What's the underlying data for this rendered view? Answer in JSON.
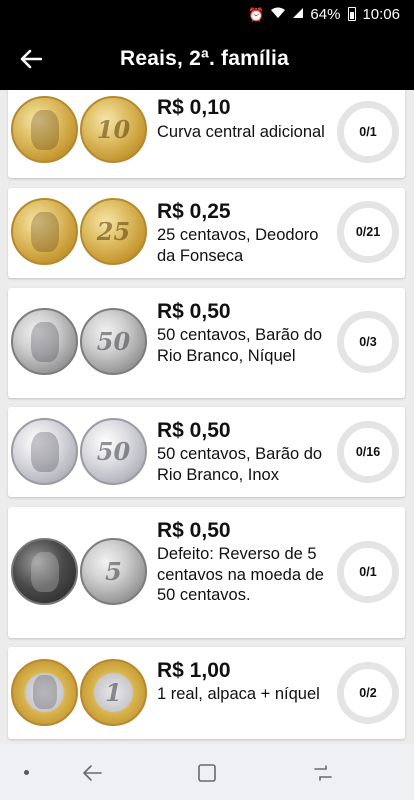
{
  "status_bar": {
    "battery": "64%",
    "time": "10:06"
  },
  "app_bar": {
    "title": "Reais, 2ª. família"
  },
  "items": [
    {
      "price": "R$ 0,10",
      "description": "Curva central adicional",
      "progress": "0/1",
      "coin_style": "gold",
      "reverse_glyph": "10"
    },
    {
      "price": "R$ 0,25",
      "description": "25 centavos, Deodoro da Fonseca",
      "progress": "0/21",
      "coin_style": "gold",
      "reverse_glyph": "25"
    },
    {
      "price": "R$ 0,50",
      "description": "50 centavos, Barão do Rio Branco, Níquel",
      "progress": "0/3",
      "coin_style": "nickel",
      "reverse_glyph": "50"
    },
    {
      "price": "R$ 0,50",
      "description": "50 centavos, Barão do Rio Branco, Inox",
      "progress": "0/16",
      "coin_style": "silver",
      "reverse_glyph": "50"
    },
    {
      "price": "R$ 0,50",
      "description": "Defeito: Reverso de 5 centavos na moeda de 50 centavos.",
      "progress": "0/1",
      "coin_style": "dark",
      "reverse_glyph": "5"
    },
    {
      "price": "R$ 1,00",
      "description": "1 real, alpaca + níquel",
      "progress": "0/2",
      "coin_style": "bimetal",
      "reverse_glyph": "1"
    }
  ],
  "colors": {
    "app_bar": "#000000",
    "background": "#ececec",
    "card": "#ffffff",
    "progress_ring": "#e4e4e4"
  }
}
